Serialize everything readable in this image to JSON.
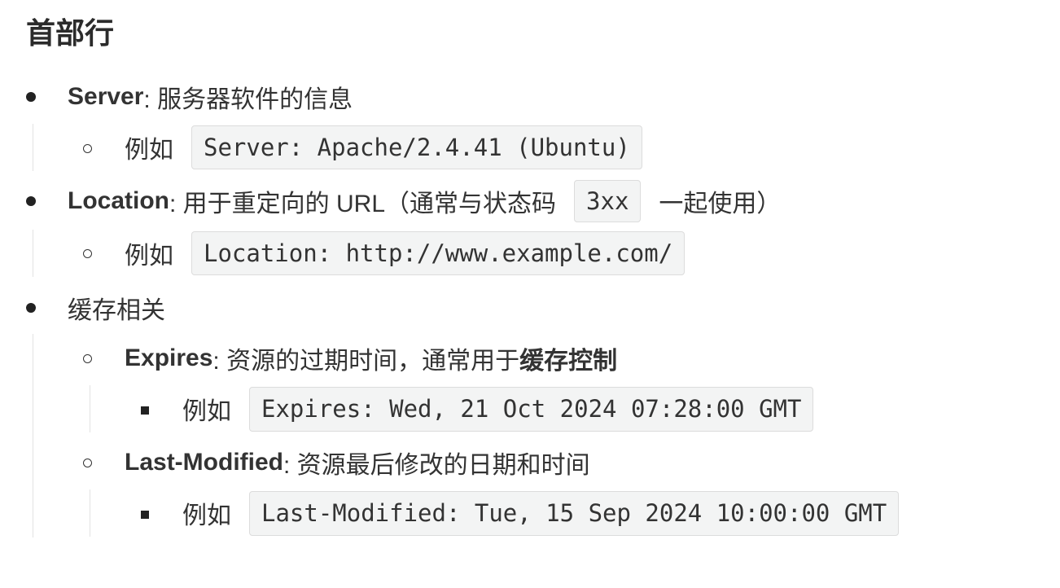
{
  "heading": "首部行",
  "items": {
    "server": {
      "term": "Server",
      "desc": ": 服务器软件的信息",
      "example_label": "例如",
      "example_code": "Server: Apache/2.4.41 (Ubuntu)"
    },
    "location": {
      "term": "Location",
      "desc_before": ": 用于重定向的 URL（通常与状态码",
      "inline_code": "3xx",
      "desc_after": "一起使用）",
      "example_label": "例如",
      "example_code": "Location: http://www.example.com/"
    },
    "cache": {
      "label": "缓存相关",
      "expires": {
        "term": "Expires",
        "desc": ": 资源的过期时间，通常用于",
        "desc_bold": "缓存控制",
        "example_label": "例如",
        "example_code": "Expires: Wed, 21 Oct 2024 07:28:00 GMT"
      },
      "last_modified": {
        "term": "Last-Modified",
        "desc": ": 资源最后修改的日期和时间",
        "example_label": "例如",
        "example_code": "Last-Modified: Tue, 15 Sep 2024 10:00:00 GMT"
      }
    }
  }
}
